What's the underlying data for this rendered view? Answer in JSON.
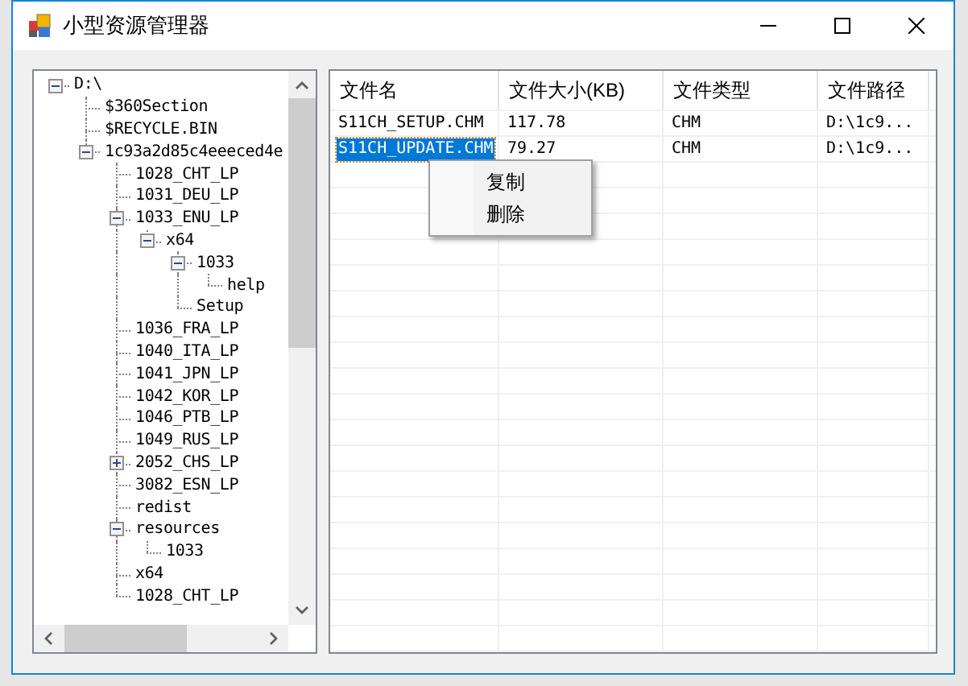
{
  "window": {
    "title": "小型资源管理器"
  },
  "tree": [
    {
      "label": "D:\\",
      "expanded": true,
      "children": [
        {
          "label": "$360Section"
        },
        {
          "label": "$RECYCLE.BIN"
        },
        {
          "label": "1c93a2d85c4eeeced4e",
          "expanded": true,
          "children": [
            {
              "label": "1028_CHT_LP"
            },
            {
              "label": "1031_DEU_LP"
            },
            {
              "label": "1033_ENU_LP",
              "expanded": true,
              "children": [
                {
                  "label": "x64",
                  "expanded": true,
                  "children": [
                    {
                      "label": "1033",
                      "expanded": true,
                      "children": [
                        {
                          "label": "help"
                        }
                      ]
                    },
                    {
                      "label": "Setup"
                    }
                  ]
                }
              ]
            },
            {
              "label": "1036_FRA_LP"
            },
            {
              "label": "1040_ITA_LP"
            },
            {
              "label": "1041_JPN_LP"
            },
            {
              "label": "1042_KOR_LP"
            },
            {
              "label": "1046_PTB_LP"
            },
            {
              "label": "1049_RUS_LP"
            },
            {
              "label": "2052_CHS_LP",
              "expanded": false
            },
            {
              "label": "3082_ESN_LP"
            },
            {
              "label": "redist"
            },
            {
              "label": "resources",
              "expanded": true,
              "children": [
                {
                  "label": "1033"
                }
              ]
            },
            {
              "label": "x64"
            },
            {
              "label": "1028_CHT_LP"
            }
          ]
        }
      ]
    }
  ],
  "table": {
    "columns": [
      "文件名",
      "文件大小(KB)",
      "文件类型",
      "文件路径"
    ],
    "rows": [
      {
        "cells": [
          "S11CH_SETUP.CHM",
          "117.78",
          "CHM",
          "D:\\1c9..."
        ],
        "selected": false
      },
      {
        "cells": [
          "S11CH_UPDATE.CHM",
          "79.27",
          "CHM",
          "D:\\1c9..."
        ],
        "selected": true
      }
    ]
  },
  "context_menu": [
    "复制",
    "删除"
  ]
}
